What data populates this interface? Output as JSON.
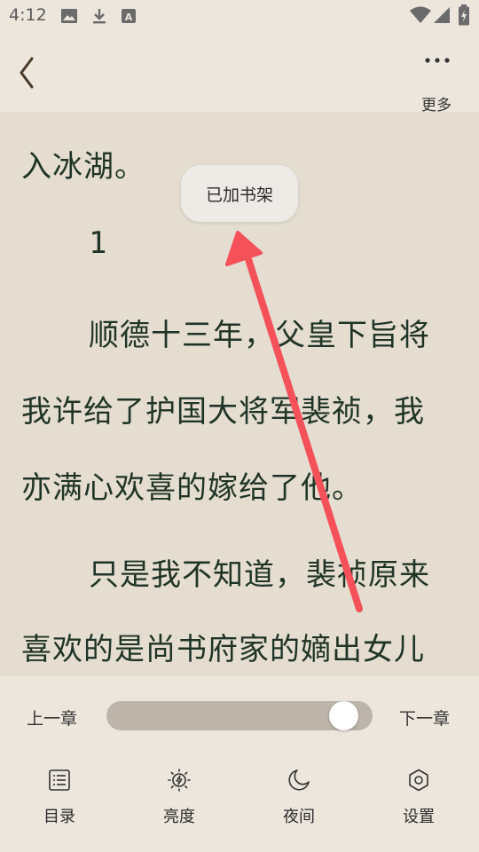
{
  "status_bar": {
    "time": "4:12",
    "left_icons": [
      "image-icon",
      "download-icon",
      "text-a-icon"
    ],
    "right_icons": [
      "wifi-icon",
      "signal-icon",
      "battery-icon"
    ]
  },
  "top_bar": {
    "back_icon": "chevron-left-icon",
    "more_label": "更多"
  },
  "reader": {
    "lines": [
      "入冰湖。",
      "1",
      "顺德十三年，父皇下旨将",
      "我许给了护国大将军裴祯，我",
      "亦满心欢喜的嫁给了他。",
      "只是我不知道，裴祯原来",
      "喜欢的是尚书府家的嫡出女儿"
    ]
  },
  "toast": {
    "text": "已加书架"
  },
  "annotation": {
    "type": "arrow",
    "color": "#f4515a"
  },
  "bottom_panel": {
    "prev_chapter": "上一章",
    "next_chapter": "下一章",
    "progress": 0.94,
    "nav": [
      {
        "label": "目录",
        "icon": "list-icon"
      },
      {
        "label": "亮度",
        "icon": "brightness-icon"
      },
      {
        "label": "夜间",
        "icon": "moon-icon"
      },
      {
        "label": "设置",
        "icon": "settings-hexagon-icon"
      }
    ]
  },
  "colors": {
    "background": "#ece6dc",
    "reader_background": "#e4ddd0",
    "text": "#1f3426",
    "slider_track": "#bdb5aa"
  }
}
